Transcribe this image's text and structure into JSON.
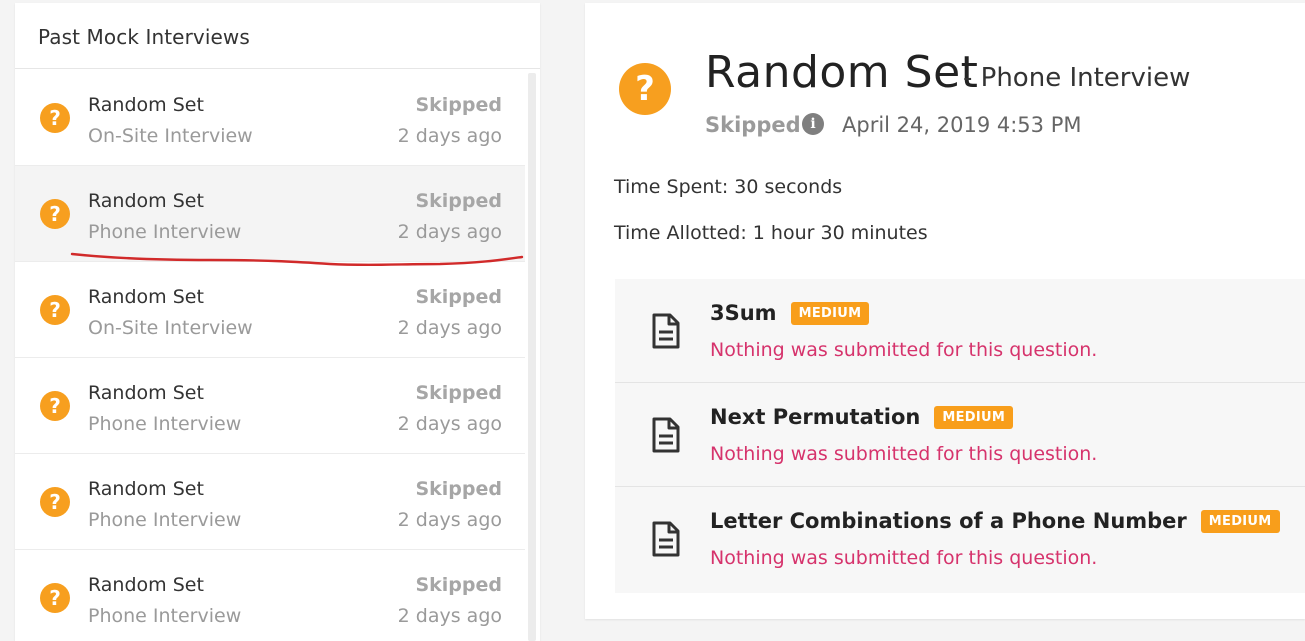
{
  "left_panel": {
    "title": "Past Mock Interviews",
    "items": [
      {
        "title": "Random Set",
        "type": "On-Site Interview",
        "status": "Skipped",
        "time": "2 days ago"
      },
      {
        "title": "Random Set",
        "type": "Phone Interview",
        "status": "Skipped",
        "time": "2 days ago"
      },
      {
        "title": "Random Set",
        "type": "On-Site Interview",
        "status": "Skipped",
        "time": "2 days ago"
      },
      {
        "title": "Random Set",
        "type": "Phone Interview",
        "status": "Skipped",
        "time": "2 days ago"
      },
      {
        "title": "Random Set",
        "type": "Phone Interview",
        "status": "Skipped",
        "time": "2 days ago"
      },
      {
        "title": "Random Set",
        "type": "Phone Interview",
        "status": "Skipped",
        "time": "2 days ago"
      }
    ]
  },
  "detail": {
    "icon": "question-circle-icon",
    "title": "Random Set",
    "subtitle": "- Phone Interview",
    "status": "Skipped",
    "date": "April 24, 2019 4:53 PM",
    "time_spent": "Time Spent: 30 seconds",
    "time_allotted": "Time Allotted: 1 hour 30 minutes",
    "questions": [
      {
        "name": "3Sum",
        "difficulty": "MEDIUM",
        "message": "Nothing was submitted for this question."
      },
      {
        "name": "Next Permutation",
        "difficulty": "MEDIUM",
        "message": "Nothing was submitted for this question."
      },
      {
        "name": "Letter Combinations of a Phone Number",
        "difficulty": "MEDIUM",
        "message": "Nothing was submitted for this question."
      }
    ]
  },
  "colors": {
    "accent_orange": "#f79f1f",
    "badge_orange": "#f89e1b",
    "error_pink": "#d6336c",
    "annotation_red": "#d12a2a"
  }
}
